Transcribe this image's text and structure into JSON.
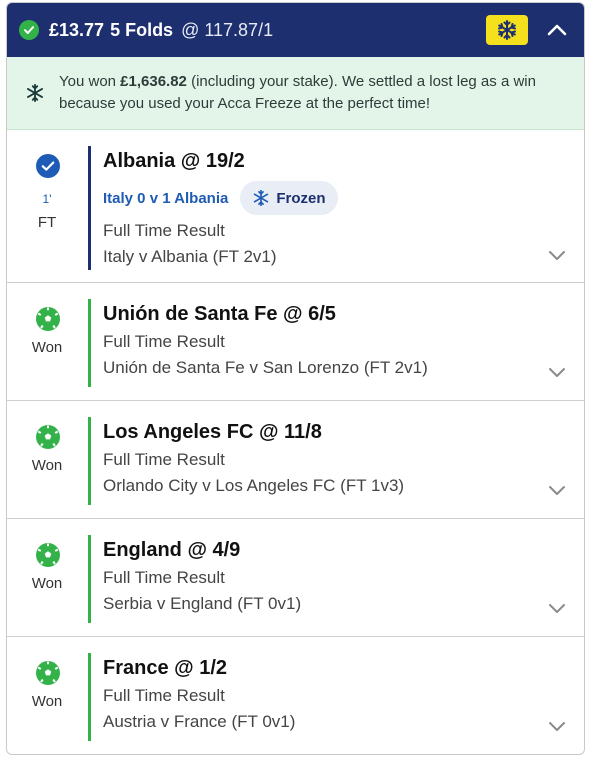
{
  "header": {
    "stake": "£13.77",
    "folds": "5 Folds",
    "odds": "@ 117.87/1",
    "freeze_icon": "snowflake-icon",
    "collapse_icon": "chevron-up-icon"
  },
  "banner": {
    "pre": "You won ",
    "amount": "£1,636.82",
    "post": " (including your stake). We settled a lost leg as a win because you used your Acca Freeze at the perfect time!"
  },
  "legs": [
    {
      "selection": "Albania @ 19/2",
      "minute": "1'",
      "status": "FT",
      "score": "Italy 0 v 1 Albania",
      "frozen_label": "Frozen",
      "market": "Full Time Result",
      "event": "Italy v Albania (FT 2v1)"
    },
    {
      "selection": "Unión de Santa Fe @ 6/5",
      "status": "Won",
      "market": "Full Time Result",
      "event": "Unión de Santa Fe v San Lorenzo (FT 2v1)"
    },
    {
      "selection": "Los Angeles FC @ 11/8",
      "status": "Won",
      "market": "Full Time Result",
      "event": "Orlando City v Los Angeles FC (FT 1v3)"
    },
    {
      "selection": "England @ 4/9",
      "status": "Won",
      "market": "Full Time Result",
      "event": "Serbia v England (FT 0v1)"
    },
    {
      "selection": "France @ 1/2",
      "status": "Won",
      "market": "Full Time Result",
      "event": "Austria v France (FT 0v1)"
    }
  ],
  "colors": {
    "header_bg": "#1d2f6e",
    "won_green": "#34b24a",
    "banner_bg": "#e3f5e8",
    "freeze_yellow": "#f5e01e",
    "link_blue": "#1e5bb5"
  }
}
